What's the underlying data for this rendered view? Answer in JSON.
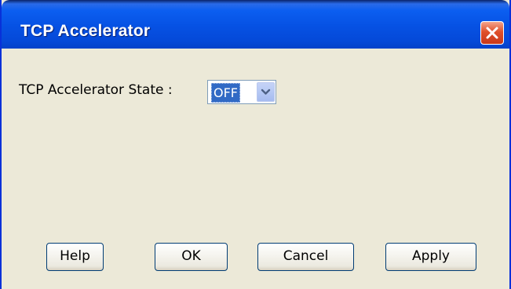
{
  "window": {
    "title": "TCP Accelerator"
  },
  "icons": {
    "close": "close-icon",
    "dropdown": "chevron-down-icon"
  },
  "colors": {
    "titlebar": "#0651e3",
    "close_button": "#e0502a",
    "dialog_background": "#ece9d8",
    "selection_highlight": "#316ac5"
  },
  "form": {
    "state_label": "TCP Accelerator State :",
    "state_value": "OFF"
  },
  "buttons": {
    "help": "Help",
    "ok": "OK",
    "cancel": "Cancel",
    "apply": "Apply"
  }
}
